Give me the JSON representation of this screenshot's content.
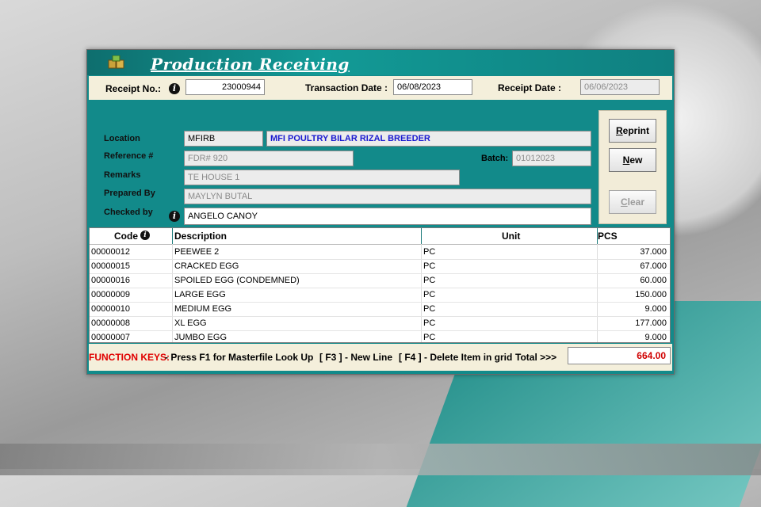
{
  "window": {
    "title": "Production Receiving"
  },
  "header": {
    "receipt_no_label": "Receipt No.:",
    "receipt_no": "23000944",
    "transaction_date_label": "Transaction Date :",
    "transaction_date": "06/08/2023",
    "receipt_date_label": "Receipt Date :",
    "receipt_date": "06/06/2023"
  },
  "form": {
    "location_label": "Location",
    "location_code": "MFIRB",
    "location_name": "MFI POULTRY BILAR RIZAL BREEDER",
    "reference_label": "Reference #",
    "reference": "FDR# 920",
    "batch_label": "Batch:",
    "batch": "01012023",
    "remarks_label": "Remarks",
    "remarks": "TE HOUSE 1",
    "prepared_by_label": "Prepared By",
    "prepared_by": "MAYLYN BUTAL",
    "checked_by_label": "Checked by",
    "checked_by": "ANGELO CANOY"
  },
  "buttons": {
    "reprint_first": "R",
    "reprint_rest": "eprint",
    "new_first": "N",
    "new_rest": "ew",
    "clear_first": "C",
    "clear_rest": "lear"
  },
  "grid": {
    "columns": [
      "Code",
      "Description",
      "Unit",
      "PCS"
    ],
    "rows": [
      {
        "code": "00000012",
        "description": "PEEWEE 2",
        "unit": "PC",
        "pcs": "37.000"
      },
      {
        "code": "00000015",
        "description": "CRACKED EGG",
        "unit": "PC",
        "pcs": "67.000"
      },
      {
        "code": "00000016",
        "description": "SPOILED EGG (CONDEMNED)",
        "unit": "PC",
        "pcs": "60.000"
      },
      {
        "code": "00000009",
        "description": "LARGE EGG",
        "unit": "PC",
        "pcs": "150.000"
      },
      {
        "code": "00000010",
        "description": "MEDIUM EGG",
        "unit": "PC",
        "pcs": "9.000"
      },
      {
        "code": "00000008",
        "description": "XL EGG",
        "unit": "PC",
        "pcs": "177.000"
      },
      {
        "code": "00000007",
        "description": "JUMBO EGG",
        "unit": "PC",
        "pcs": "9.000"
      }
    ]
  },
  "footer": {
    "function_keys_label": "FUNCTION KEYS: ",
    "f1_hint": "- Press F1 for Masterfile Look Up",
    "f3_hint": "[ F3 ] - New Line",
    "f4_hint": "[ F4 ] - Delete Item in grid",
    "total_label": "Total >>>",
    "total": "664.00"
  },
  "icons": {
    "title": "boxes-icon",
    "info": "info-icon"
  },
  "colors": {
    "window_bg": "#128a8a",
    "panel_bg": "#f4efdb",
    "accent_red": "#e00000",
    "link_blue": "#1a1ad0"
  }
}
